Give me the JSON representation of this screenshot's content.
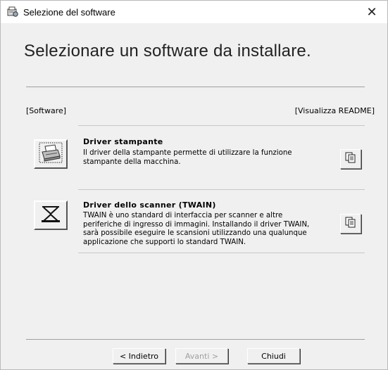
{
  "window": {
    "title": "Selezione del software",
    "close_glyph": "✕",
    "app_icon": "software-setup-icon"
  },
  "heading": "Selezionare un software da installare.",
  "section": {
    "left_label": "[Software]",
    "right_label": "[Visualizza README]"
  },
  "items": [
    {
      "title": "Driver stampante",
      "description_lines": [
        "Il driver della stampante permette di utilizzare la funzione",
        "stampante della macchina."
      ],
      "icon": "printer-icon",
      "readme_icon": "document-icon"
    },
    {
      "title": "Driver dello scanner (TWAIN)",
      "description_lines": [
        "TWAIN è uno standard di interfaccia per scanner e altre",
        "periferiche di ingresso di immagini. Installando il driver TWAIN,",
        "sarà possibile eseguire le scansioni utilizzando una qualunque",
        "applicazione che supporti lo standard TWAIN."
      ],
      "icon": "scanner-icon",
      "readme_icon": "document-icon"
    }
  ],
  "buttons": {
    "back": "< Indietro",
    "next": "Avanti >",
    "close": "Chiudi"
  },
  "colors": {
    "background": "#f0f0f0",
    "titlebar": "#ffffff",
    "disabled_text": "#a0a0a0"
  }
}
